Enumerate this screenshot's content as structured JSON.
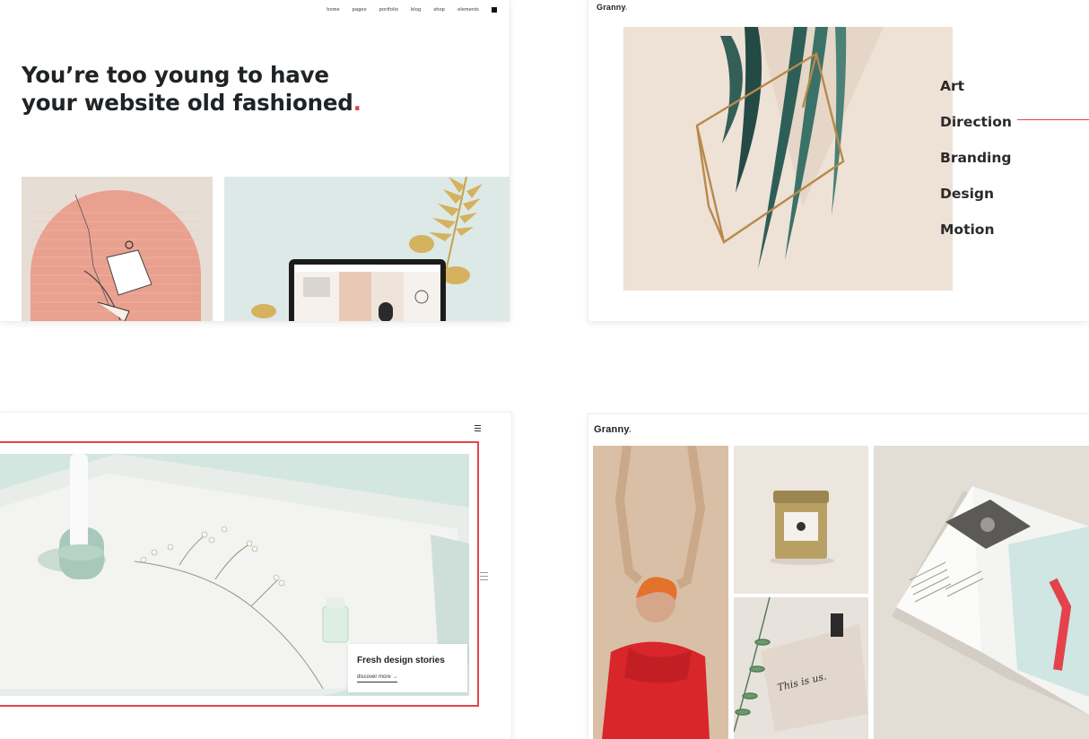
{
  "demo_1": {
    "nav": [
      "home",
      "pages",
      "portfolio",
      "blog",
      "shop",
      "elements"
    ],
    "headline_line1": "You’re too young to have",
    "headline_line2": "your website old fashioned",
    "headline_dot": "."
  },
  "demo_2": {
    "logo_text": "Granny",
    "logo_dot": ".",
    "services": [
      "Art",
      "Direction",
      "Branding",
      "Design",
      "Motion"
    ],
    "active_service": "Direction"
  },
  "demo_3": {
    "story_title": "Fresh design stories",
    "story_link": "discover more",
    "story_link_arrow": "→"
  },
  "demo_4": {
    "logo_text": "Granny",
    "logo_dot": ".",
    "note_text": "This is us."
  },
  "colors": {
    "accent": "#e4434c",
    "text_dark": "#1f2326",
    "beige": "#eee1d6",
    "mint": "#d3e7e0"
  },
  "icons": [
    "menu-icon",
    "cart-icon",
    "arrow-right-icon"
  ]
}
